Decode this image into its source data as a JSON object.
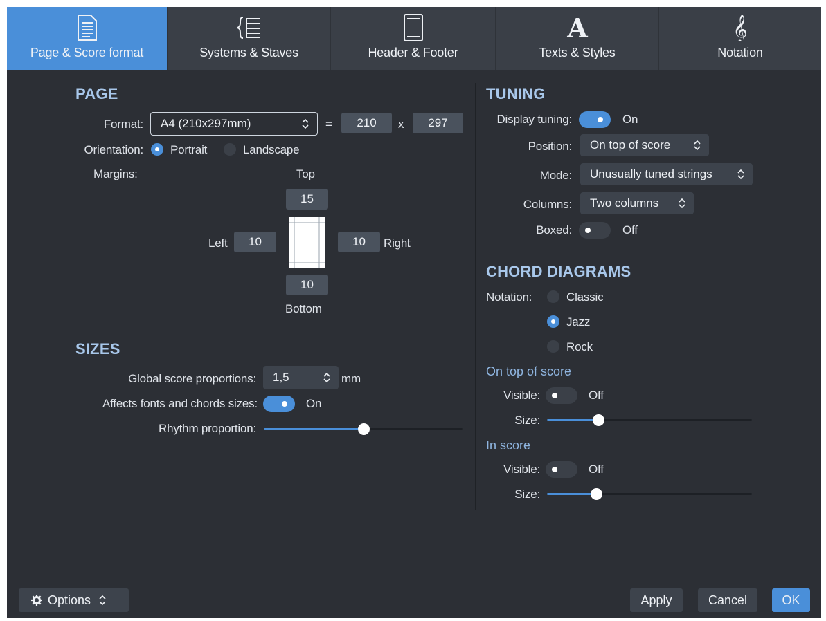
{
  "tabs": [
    {
      "label": "Page & Score format",
      "icon": "page-icon",
      "active": true
    },
    {
      "label": "Systems & Staves",
      "icon": "staves-icon",
      "active": false
    },
    {
      "label": "Header & Footer",
      "icon": "header-footer-icon",
      "active": false
    },
    {
      "label": "Texts & Styles",
      "icon": "text-a-icon",
      "active": false
    },
    {
      "label": "Notation",
      "icon": "treble-clef-icon",
      "active": false
    }
  ],
  "page": {
    "heading": "PAGE",
    "format_label": "Format:",
    "format_value": "A4 (210x297mm)",
    "equals": "=",
    "width": "210",
    "times": "x",
    "height": "297",
    "orientation_label": "Orientation:",
    "portrait": "Portrait",
    "landscape": "Landscape",
    "orientation_selected": "Portrait",
    "margins_label": "Margins:",
    "top_label": "Top",
    "top": "15",
    "left_label": "Left",
    "left": "10",
    "right": "10",
    "right_label": "Right",
    "bottom": "10",
    "bottom_label": "Bottom"
  },
  "sizes": {
    "heading": "SIZES",
    "global_label": "Global score proportions:",
    "global_value": "1,5",
    "global_unit": "mm",
    "affects_label": "Affects fonts and chords sizes:",
    "affects_state": "On",
    "rhythm_label": "Rhythm proportion:",
    "rhythm_fraction": 0.5
  },
  "tuning": {
    "heading": "TUNING",
    "display_label": "Display tuning:",
    "display_state": "On",
    "position_label": "Position:",
    "position_value": "On top of score",
    "mode_label": "Mode:",
    "mode_value": "Unusually tuned strings",
    "columns_label": "Columns:",
    "columns_value": "Two columns",
    "boxed_label": "Boxed:",
    "boxed_state": "Off"
  },
  "chords": {
    "heading": "CHORD DIAGRAMS",
    "notation_label": "Notation:",
    "classic": "Classic",
    "jazz": "Jazz",
    "rock": "Rock",
    "notation_selected": "Jazz",
    "on_top": {
      "heading": "On top of score",
      "visible_label": "Visible:",
      "visible_state": "Off",
      "size_label": "Size:",
      "size_fraction": 0.25
    },
    "in_score": {
      "heading": "In score",
      "visible_label": "Visible:",
      "visible_state": "Off",
      "size_label": "Size:",
      "size_fraction": 0.24
    }
  },
  "footer": {
    "options_label": "Options",
    "apply_label": "Apply",
    "cancel_label": "Cancel",
    "ok_label": "OK"
  },
  "colors": {
    "accent": "#4a8fd9",
    "background": "#2c2f35",
    "tabbar": "#3a3f47",
    "heading": "#a8c7ea"
  }
}
